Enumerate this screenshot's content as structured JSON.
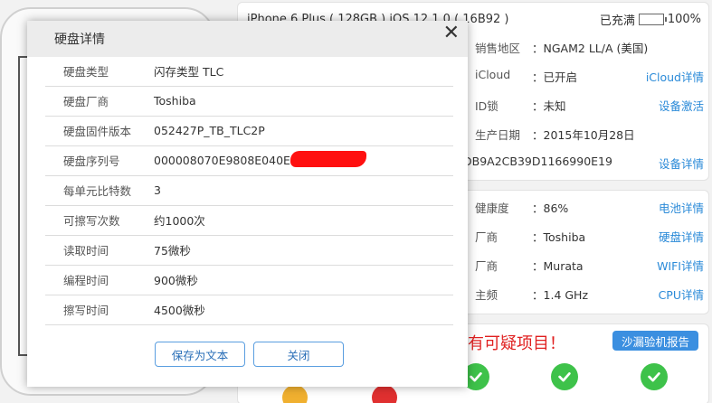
{
  "device": {
    "model": "iPhone 6 Plus ( 128GB ) iOS 12.1.0 ( 16B92 )",
    "battery_status": "已充满",
    "battery_level": "100%",
    "battery_fraction": 1.0
  },
  "info_rows": [
    {
      "label": "销售地区",
      "value": "NGAM2 LL/A (美国)",
      "link": ""
    },
    {
      "label": "iCloud",
      "value": "已开启",
      "link": "iCloud详情"
    },
    {
      "label": "ID锁",
      "value": "未知",
      "link": "设备激活"
    },
    {
      "label": "生产日期",
      "value": "2015年10月28日",
      "link": ""
    },
    {
      "label": "",
      "value": "DB9A2CB39D1166990E19",
      "link": "设备详情"
    },
    {
      "label": "健康度",
      "value": "86%",
      "link": "电池详情"
    },
    {
      "label": "厂商",
      "value": "Toshiba",
      "link": "硬盘详情"
    },
    {
      "label": "厂商",
      "value": "Murata",
      "link": "WIFI详情"
    },
    {
      "label": "主频",
      "value": "1.4 GHz",
      "link": "CPU详情"
    }
  ],
  "separator": "：",
  "warning_text": "有可疑项目！",
  "report_button": "沙漏验机报告",
  "modal": {
    "title": "硬盘详情",
    "close_glyph": "✕",
    "rows": [
      {
        "key": "硬盘类型",
        "value": "闪存类型 TLC"
      },
      {
        "key": "硬盘厂商",
        "value": "Toshiba"
      },
      {
        "key": "硬盘固件版本",
        "value": "052427P_TB_TLC2P"
      },
      {
        "key": "硬盘序列号",
        "value": "000008070E9808E040E04"
      },
      {
        "key": "每单元比特数",
        "value": "3"
      },
      {
        "key": "可擦写次数",
        "value": "约1000次"
      },
      {
        "key": "读取时间",
        "value": "75微秒"
      },
      {
        "key": "编程时间",
        "value": "900微秒"
      },
      {
        "key": "擦写时间",
        "value": "4500微秒"
      }
    ],
    "save_button": "保存为文本",
    "close_button": "关闭"
  },
  "colors": {
    "accent": "#2a8ad8",
    "warning": "#e02020",
    "check": "#3ec24a",
    "battery": "#3fd04c"
  }
}
